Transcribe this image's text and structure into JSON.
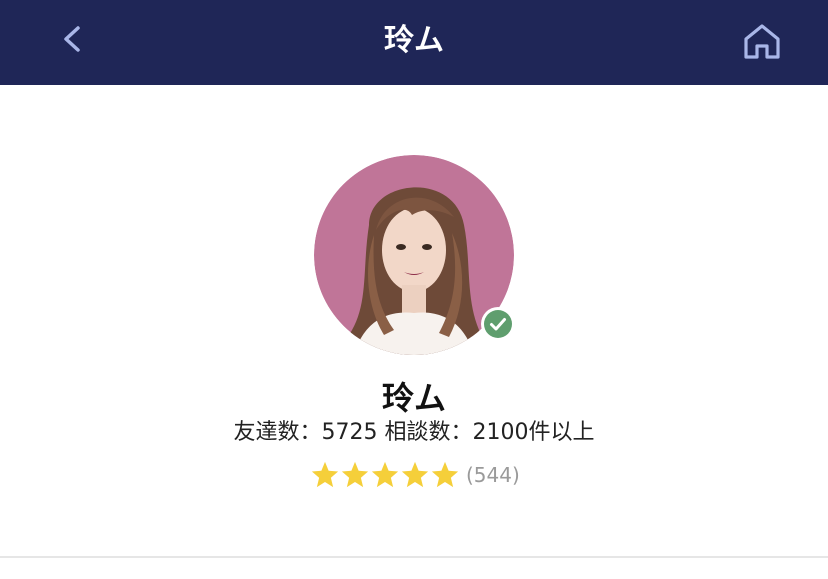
{
  "header": {
    "title": "玲ム",
    "back_icon": "chevron-left-icon",
    "home_icon": "home-icon",
    "background_color": "#1f2657"
  },
  "profile": {
    "name": "玲ム",
    "verified": true,
    "verified_color": "#5f9e6e",
    "avatar_background_color": "#c07598"
  },
  "stats": {
    "friends_label": "友達数：",
    "friends_value": "5725",
    "consult_label": "相談数：",
    "consult_value": "2100件以上"
  },
  "rating": {
    "stars": 5,
    "max_stars": 5,
    "star_color": "#f5cf3a",
    "review_count_text": "(544)"
  }
}
